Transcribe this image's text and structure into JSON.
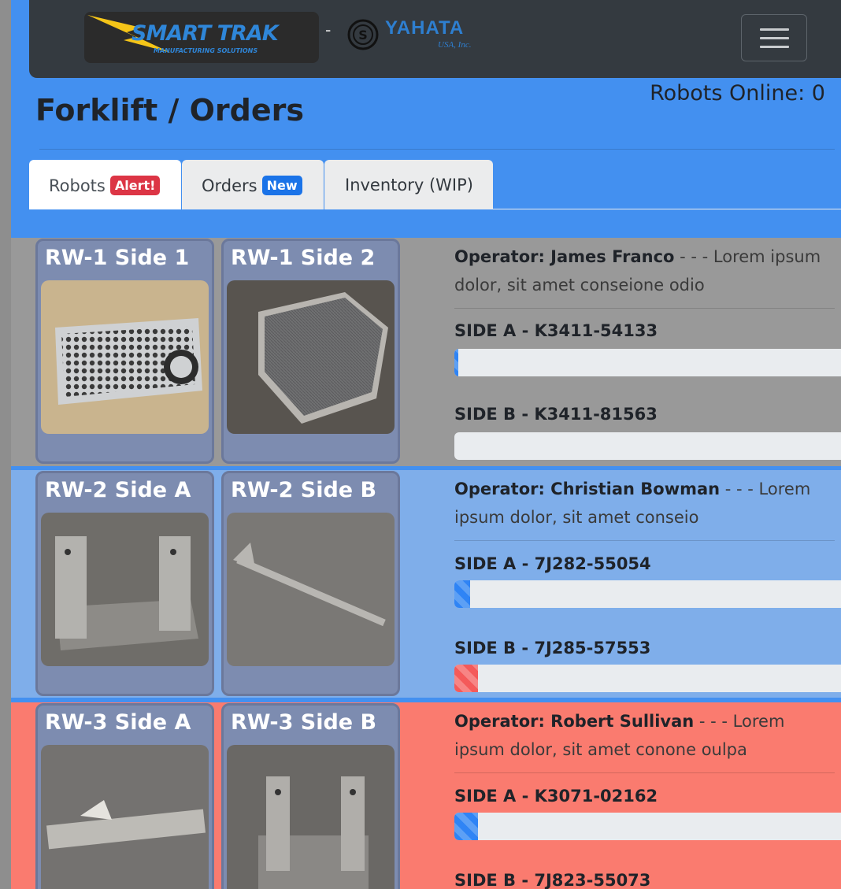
{
  "header": {
    "logo_text": "SMART TRAK",
    "logo_sub": "MANUFACTURING SOLUTIONS",
    "separator": "-",
    "partner_name": "YAHATA",
    "partner_sub": "USA, Inc."
  },
  "page": {
    "title": "Forklift / Orders",
    "robots_online": "Robots Online: 0"
  },
  "tabs": [
    {
      "label": "Robots",
      "badge": "Alert!",
      "badge_color": "#dc3545",
      "active": true
    },
    {
      "label": "Orders",
      "badge": "New",
      "badge_color": "#1a73e8",
      "active": false
    },
    {
      "label": "Inventory (WIP)",
      "badge": "",
      "active": false
    }
  ],
  "robots": [
    {
      "row_color": "#999999",
      "cards": [
        {
          "title": "RW-1 Side 1",
          "image": "perforated plate"
        },
        {
          "title": "RW-1 Side 2",
          "image": "mesh box"
        }
      ],
      "operator_label": "Operator: James Franco",
      "operator_note": " - - - Lorem ipsum dolor, sit amet conseione odio",
      "side_a": {
        "label": "SIDE A - K3411-54133",
        "progress": 0.01,
        "color": "blue"
      },
      "side_b": {
        "label": "SIDE B - K3411-81563",
        "progress": 0.0,
        "color": "blue"
      }
    },
    {
      "row_color": "#7faeea",
      "cards": [
        {
          "title": "RW-2 Side A",
          "image": "u-bracket"
        },
        {
          "title": "RW-2 Side B",
          "image": "rod"
        }
      ],
      "operator_label": "Operator: Christian Bowman",
      "operator_note": " - - - Lorem ipsum dolor, sit amet conseio",
      "side_a": {
        "label": "SIDE A - 7J282-55054",
        "progress": 0.04,
        "color": "blue"
      },
      "side_b": {
        "label": "SIDE B - 7J285-57553",
        "progress": 0.06,
        "color": "red"
      }
    },
    {
      "row_color": "#fa7b6f",
      "cards": [
        {
          "title": "RW-3 Side A",
          "image": "rail"
        },
        {
          "title": "RW-3 Side B",
          "image": "u-bracket"
        }
      ],
      "operator_label": "Operator: Robert Sullivan",
      "operator_note": " - - - Lorem ipsum dolor, sit amet conone oulpa",
      "side_a": {
        "label": "SIDE A - K3071-02162",
        "progress": 0.06,
        "color": "blue"
      },
      "side_b": {
        "label": "SIDE B - 7J823-55073",
        "progress": 0.0,
        "color": "blue"
      }
    }
  ]
}
